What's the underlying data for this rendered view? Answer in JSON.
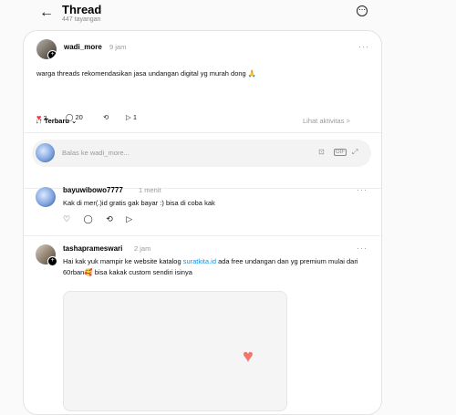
{
  "header": {
    "title": "Thread",
    "views": "447 tayangan",
    "back_icon": "←",
    "more_icon": "⋯"
  },
  "post": {
    "username": "wadi_more",
    "time": "9 jam",
    "text": "warga threads rekomendasikan jasa undangan digital yg murah dong 🙏",
    "likes": "3",
    "comments": "20",
    "shares": "1",
    "more": "···"
  },
  "sort": {
    "label": "↓↑ Terbaru ⌄",
    "activity": "Lihat aktivitas >"
  },
  "reply_box": {
    "placeholder": "Balas ke wadi_more..."
  },
  "replies": [
    {
      "username": "bayuwibowo7777",
      "time": "1 menit",
      "text": "Kak di mer(.)id gratis gak bayar :) bisa di coba kak",
      "more": "···"
    },
    {
      "username": "tashaprameswari",
      "time": "2 jam",
      "text_before_link": "Hai kak yuk mampir ke website katalog ",
      "link": "suratkita.id",
      "text_after_link": " ada free undangan dan yg premium mulai dari 60rban🥰 bisa kakak custom sendiri isinya",
      "more": "···"
    }
  ],
  "colors": {
    "like_red": "#ff3040",
    "link_blue": "#0095f6",
    "heart_media": "#f2776a"
  }
}
